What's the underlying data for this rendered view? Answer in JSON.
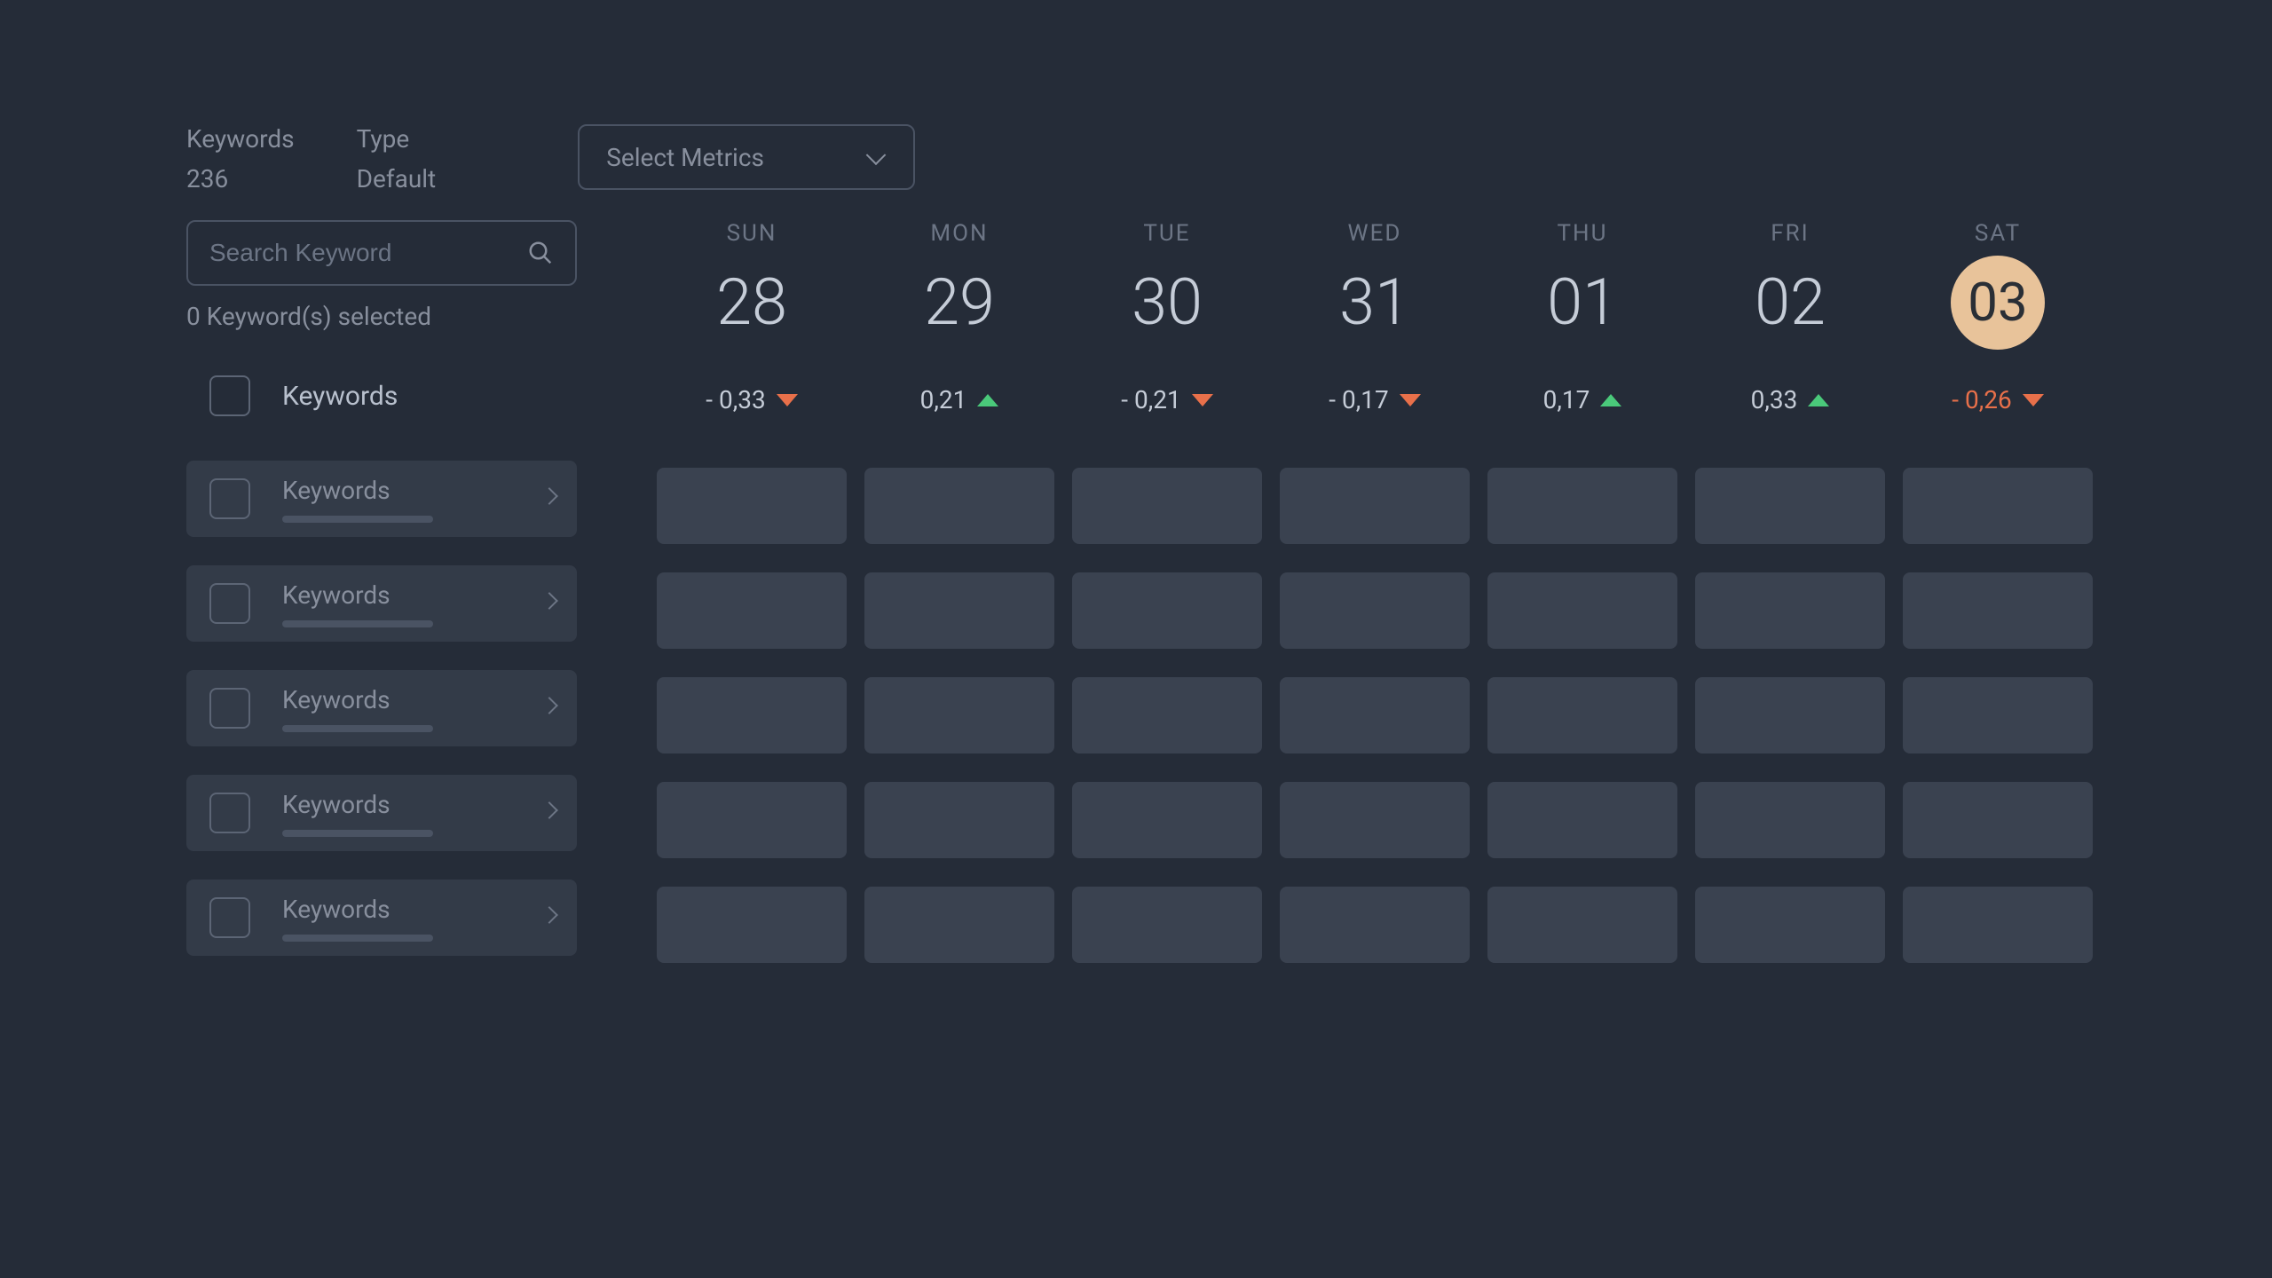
{
  "header": {
    "keywords_label": "Keywords",
    "keywords_value": "236",
    "type_label": "Type",
    "type_value": "Default",
    "metrics_placeholder": "Select Metrics"
  },
  "sidebar": {
    "search_placeholder": "Search Keyword",
    "selected_text": "0 Keyword(s) selected",
    "header_label": "Keywords",
    "rows": [
      {
        "label": "Keywords"
      },
      {
        "label": "Keywords"
      },
      {
        "label": "Keywords"
      },
      {
        "label": "Keywords"
      },
      {
        "label": "Keywords"
      }
    ]
  },
  "days": [
    {
      "name": "SUN",
      "num": "28",
      "value": "- 0,33",
      "dir": "down",
      "today": false,
      "negative": false
    },
    {
      "name": "MON",
      "num": "29",
      "value": "0,21",
      "dir": "up",
      "today": false,
      "negative": false
    },
    {
      "name": "TUE",
      "num": "30",
      "value": "- 0,21",
      "dir": "down",
      "today": false,
      "negative": false
    },
    {
      "name": "WED",
      "num": "31",
      "value": "- 0,17",
      "dir": "down",
      "today": false,
      "negative": false
    },
    {
      "name": "THU",
      "num": "01",
      "value": "0,17",
      "dir": "up",
      "today": false,
      "negative": false
    },
    {
      "name": "FRI",
      "num": "02",
      "value": "0,33",
      "dir": "up",
      "today": false,
      "negative": false
    },
    {
      "name": "SAT",
      "num": "03",
      "value": "- 0,26",
      "dir": "down",
      "today": true,
      "negative": true
    }
  ],
  "grid_rows": 5,
  "grid_cols": 7
}
